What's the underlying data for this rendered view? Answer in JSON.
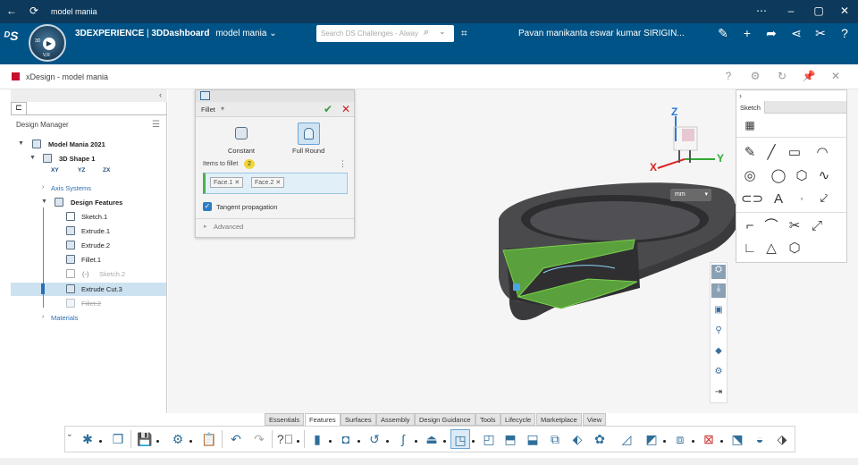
{
  "window": {
    "title": "model mania"
  },
  "topbar": {
    "brand": "3DEXPERIENCE",
    "separator": " | ",
    "dashboard": "3DDashboard",
    "tab_name": "model mania",
    "search_placeholder": "Search DS Challenges - Alway",
    "user_name": "Pavan manikanta eswar kumar SIRIGIN...",
    "compass_labels": {
      "top": "3D",
      "center": "V,R"
    }
  },
  "app": {
    "title": "xDesign - model mania"
  },
  "design_manager": {
    "label": "Design Manager",
    "tree": [
      {
        "label": "Model Mania 2021"
      },
      {
        "label": "3D Shape 1"
      },
      {
        "label": "XY"
      },
      {
        "label": "YZ"
      },
      {
        "label": "ZX"
      },
      {
        "label": "Axis Systems"
      },
      {
        "label": "Design Features"
      },
      {
        "label": "Sketch.1"
      },
      {
        "label": "Extrude.1"
      },
      {
        "label": "Extrude.2"
      },
      {
        "label": "Fillet.1"
      },
      {
        "label": "(-)"
      },
      {
        "label": "Sketch.2"
      },
      {
        "label": "Extrude Cut.3"
      },
      {
        "label": "Fillet.2"
      },
      {
        "label": "Materials"
      }
    ]
  },
  "fillet_panel": {
    "title": "Fillet",
    "option_constant": "Constant",
    "option_full_round": "Full Round",
    "items_label": "Items to fillet",
    "items_count": "2",
    "items": [
      "Face.1",
      "Face.2"
    ],
    "tangent_label": "Tangent propagation",
    "tangent_checked": true,
    "advanced_label": "Advanced"
  },
  "viewport": {
    "units": "mm",
    "axis_x": "X",
    "axis_y": "Y",
    "axis_z": "Z"
  },
  "sketch_panel": {
    "tab": "Sketch"
  },
  "bottom_tabs": [
    "Essentials",
    "Features",
    "Surfaces",
    "Assembly",
    "Design Guidance",
    "Tools",
    "Lifecycle",
    "Marketplace",
    "View"
  ],
  "colors": {
    "titlebar": "#0d3a5c",
    "topbar": "#005386",
    "selection": "#cce2f0",
    "accent_green": "#4caf50",
    "part_dark": "#3a3a3c",
    "selected_face": "#5aa03c"
  }
}
